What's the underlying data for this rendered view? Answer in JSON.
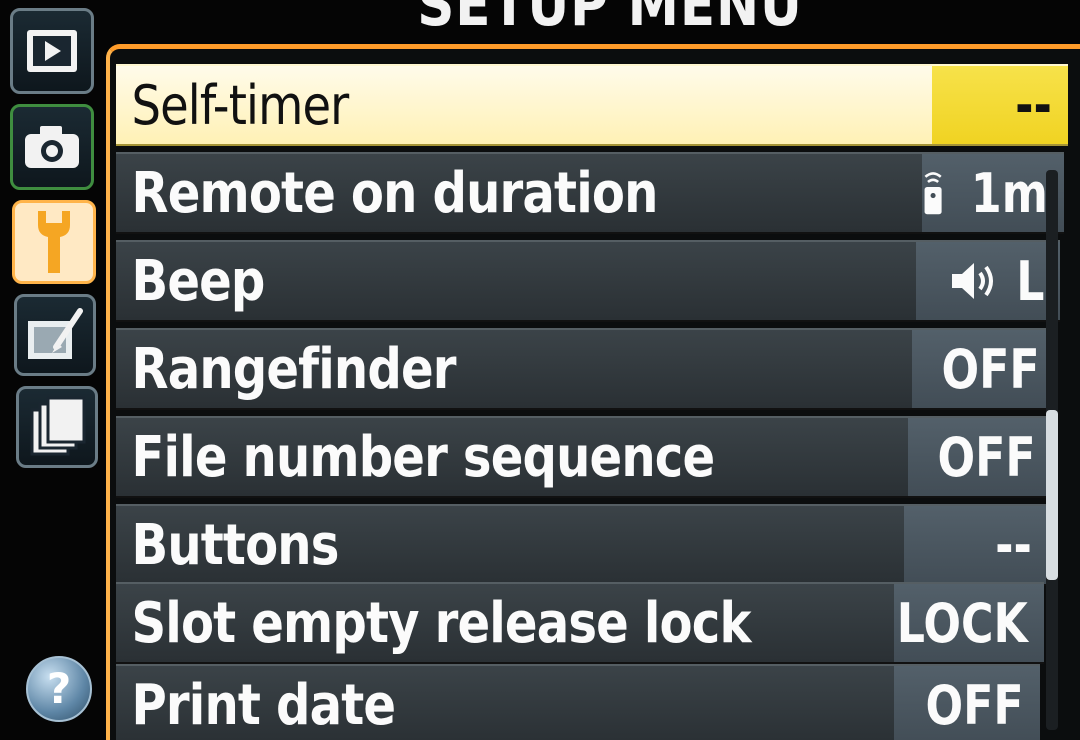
{
  "header": {
    "title": "SETUP MENU"
  },
  "tabs": [
    {
      "name": "playback",
      "icon": "playback-icon"
    },
    {
      "name": "shooting",
      "icon": "camera-icon"
    },
    {
      "name": "setup",
      "icon": "wrench-icon"
    },
    {
      "name": "retouch",
      "icon": "retouch-icon"
    },
    {
      "name": "recent-settings",
      "icon": "recent-settings-icon"
    }
  ],
  "help": {
    "label": "?"
  },
  "menu": {
    "items": [
      {
        "label": "Self-timer",
        "value": "--",
        "selected": true
      },
      {
        "label": "Remote on duration",
        "value": "1m",
        "icon": "remote-icon"
      },
      {
        "label": "Beep",
        "value": "L",
        "icon": "speaker-icon"
      },
      {
        "label": "Rangefinder",
        "value": "OFF"
      },
      {
        "label": "File number sequence",
        "value": "OFF"
      },
      {
        "label": "Buttons",
        "value": "--"
      },
      {
        "label": "Slot empty release lock",
        "value": "LOCK"
      },
      {
        "label": "Print date",
        "value": "OFF"
      }
    ]
  },
  "colors": {
    "accent_orange": "#ff9c2a",
    "selected_row": "#fff5c8",
    "selected_value": "#f3d82f",
    "row_bg": "#343b40",
    "value_bg": "#4a5660"
  }
}
